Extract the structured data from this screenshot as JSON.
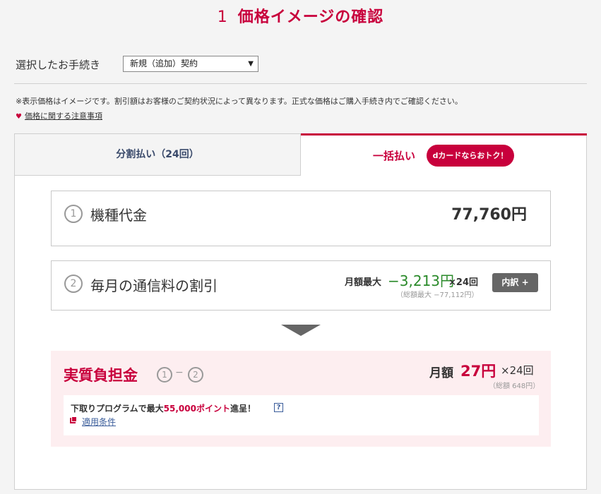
{
  "header": {
    "step_number": "1",
    "title": "価格イメージの確認"
  },
  "procedure": {
    "label": "選択したお手続き",
    "selected_value": "新規（追加）契約"
  },
  "notes": {
    "disclaimer": "※表示価格はイメージです。割引額はお客様のご契約状況によって異なります。正式な価格はご購入手続き内でご確認ください。",
    "price_notice_link": "価格に関する注意事項"
  },
  "tabs": [
    {
      "label": "分割払い（24回）",
      "active": false
    },
    {
      "label": "一括払い",
      "active": true,
      "badge": "dカードならおトク！"
    }
  ],
  "device_price": {
    "number": "1",
    "label": "機種代金",
    "value": "77,760円"
  },
  "monthly_discount": {
    "number": "2",
    "label": "毎月の通信料の割引",
    "max_label": "月額最大",
    "amount": "−3,213円",
    "times": "×24回",
    "total": "（総額最大 −77,112円）",
    "breakdown_button": "内訳"
  },
  "result": {
    "label": "実質負担金",
    "formula_left": "1",
    "formula_dash": "−",
    "formula_right": "2",
    "monthly_label": "月額",
    "monthly_value": "27円",
    "times": "×24回",
    "total": "（総額 648円）"
  },
  "tradein": {
    "text_before": "下取りプログラムで最大",
    "highlight": "55,000ポイント",
    "text_after": "進呈！",
    "help": "?",
    "conditions_link": "適用条件"
  },
  "colors": {
    "accent": "#c8003c",
    "discount_green": "#2a8a2a",
    "link_blue": "#3a5c9a",
    "result_bg": "#fdeef0"
  }
}
